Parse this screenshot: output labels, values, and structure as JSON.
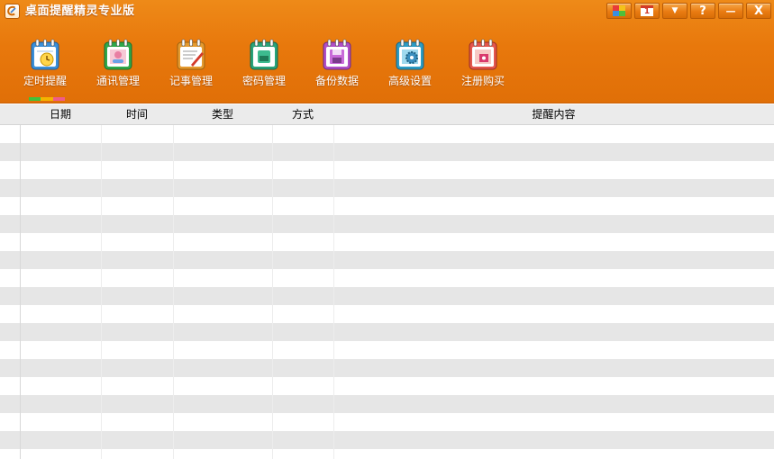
{
  "window": {
    "title": "桌面提醒精灵专业版",
    "app_icon": "app-logo-icon",
    "controls": [
      {
        "name": "skin-button",
        "icon": "color-squares-icon",
        "glyph": ""
      },
      {
        "name": "calendar-button",
        "icon": "calendar-icon",
        "glyph": "1"
      },
      {
        "name": "menu-button",
        "icon": "triangle-down-icon",
        "glyph": "▼"
      },
      {
        "name": "help-button",
        "icon": "help-icon",
        "glyph": "?"
      },
      {
        "name": "minimize-button",
        "icon": "minimize-icon",
        "glyph": "—"
      },
      {
        "name": "close-button",
        "icon": "close-icon",
        "glyph": "X"
      }
    ]
  },
  "toolbar": {
    "items": [
      {
        "label": "定时提醒",
        "icon": "alarm-clock-icon",
        "color": "#3a8fd9"
      },
      {
        "label": "通讯管理",
        "icon": "contacts-icon",
        "color": "#2fa84a"
      },
      {
        "label": "记事管理",
        "icon": "notepad-icon",
        "color": "#e59a2f"
      },
      {
        "label": "密码管理",
        "icon": "password-icon",
        "color": "#29a37a"
      },
      {
        "label": "备份数据",
        "icon": "backup-icon",
        "color": "#b04fc7"
      },
      {
        "label": "高级设置",
        "icon": "settings-gear-icon",
        "color": "#2c9cc4"
      },
      {
        "label": "注册购买",
        "icon": "register-icon",
        "color": "#e4574d"
      }
    ],
    "selected_index": 0,
    "selection_colors": [
      "#3fc23a",
      "#f4b400",
      "#ee5c8a"
    ]
  },
  "table": {
    "columns": [
      "日期",
      "时间",
      "类型",
      "方式",
      "提醒内容"
    ],
    "rows": []
  },
  "colors": {
    "header_orange": "#e8780c",
    "row_alt": "#e6e6e6",
    "header_gray": "#ebebeb"
  }
}
